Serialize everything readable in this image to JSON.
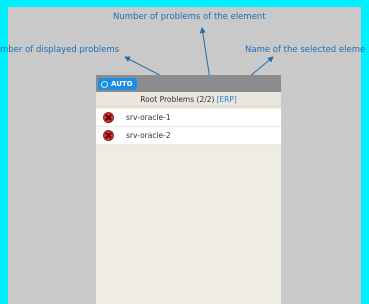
{
  "annotations": {
    "top": "Number of problems of the element",
    "left": "mber of displayed problems",
    "right": "Name of  the selected eleme"
  },
  "panel": {
    "auto_button": "AUTO",
    "title_prefix": "Root Problems (2/2)",
    "selected_name": "[ERP]",
    "items": [
      {
        "label": "srv-oracle-1",
        "icon": "error-icon"
      },
      {
        "label": "srv-oracle-2",
        "icon": "error-icon"
      }
    ]
  },
  "colors": {
    "accent": "#1b8fe3",
    "annotation": "#1d6fb3",
    "error": "#e02a2a",
    "frame": "#00eefe"
  }
}
